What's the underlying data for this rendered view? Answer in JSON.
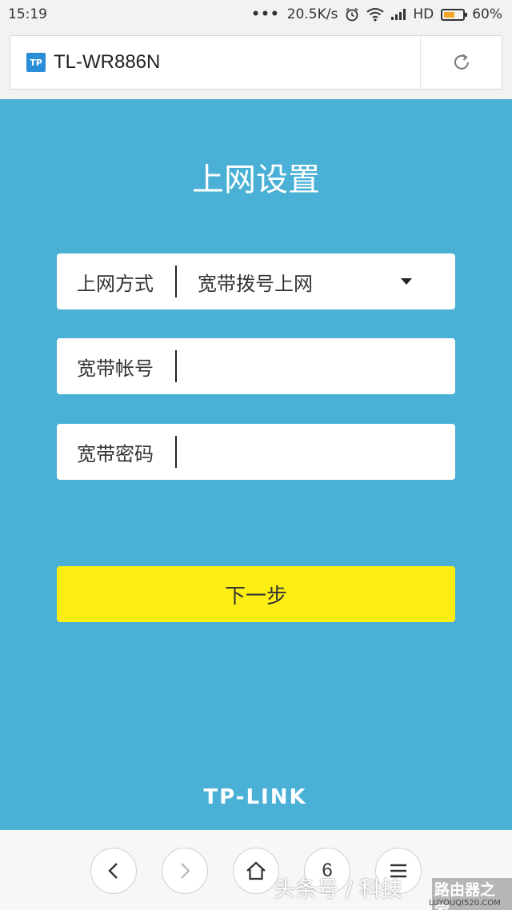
{
  "status_bar": {
    "time": "15:19",
    "network_speed": "20.5K/s",
    "network_type": "HD",
    "battery": "60%",
    "battery_level": 0.6,
    "icons": [
      "more-dots-icon",
      "alarm-icon",
      "wifi-icon",
      "signal-icon",
      "battery-icon"
    ]
  },
  "browser": {
    "favicon_text": "TP",
    "page_title": "TL-WR886N",
    "reload_icon": "reload-icon"
  },
  "page": {
    "title": "上网设置",
    "connection_type": {
      "label": "上网方式",
      "selected": "宽带拨号上网"
    },
    "account": {
      "label": "宽带帐号",
      "value": ""
    },
    "password": {
      "label": "宽带密码",
      "value": ""
    },
    "next_button": "下一步",
    "brand": "TP-LINK"
  },
  "bottom_nav": {
    "back_icon": "chevron-left-icon",
    "forward_icon": "chevron-right-icon",
    "home_icon": "home-icon",
    "tab_count": "6",
    "menu_icon": "menu-icon"
  },
  "watermark": {
    "text": "头条号 / 科技",
    "site": "路由器之家",
    "site_url": "LUYOUQI520.COM"
  },
  "colors": {
    "background": "#4ab0d6",
    "button": "#fced15",
    "battery": "#f5a623",
    "favicon": "#2a8ed6"
  }
}
